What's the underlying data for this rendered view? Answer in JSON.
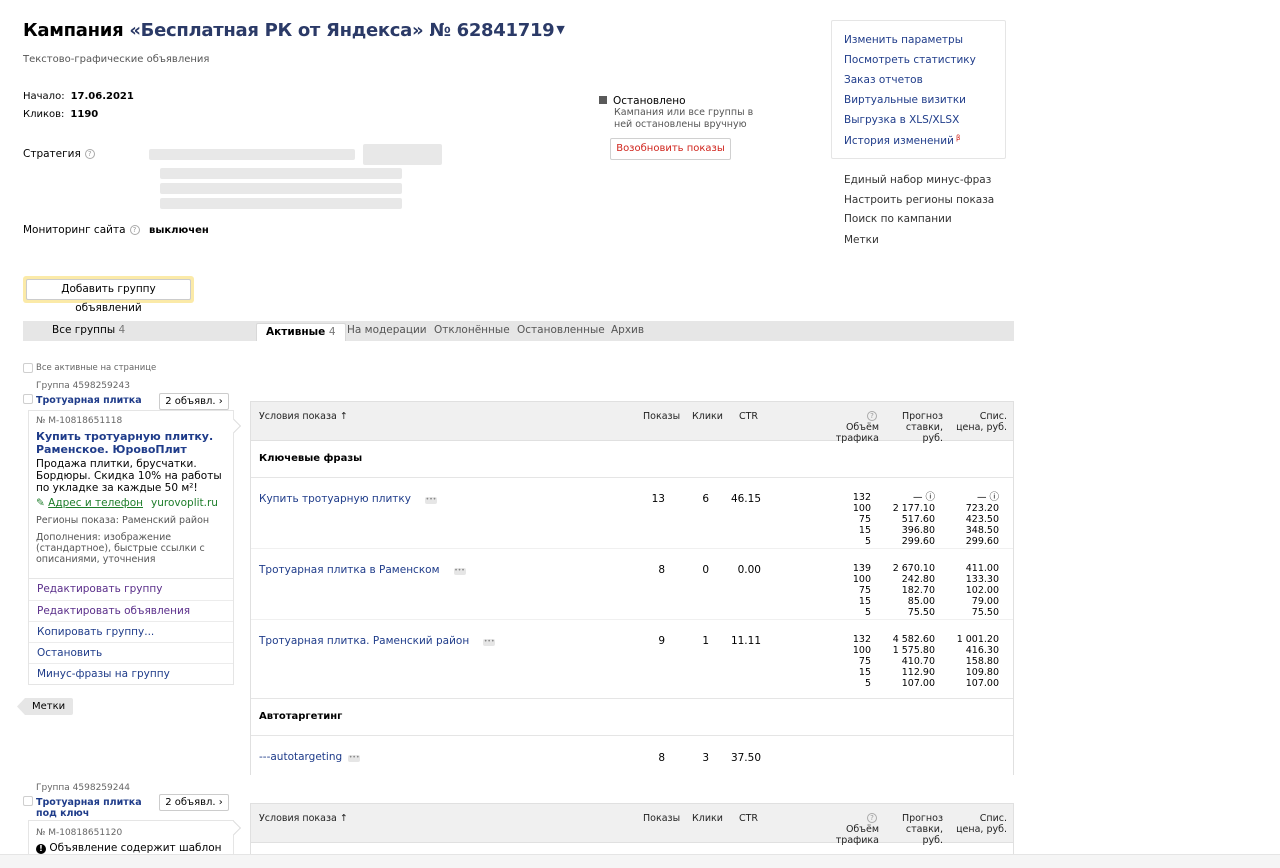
{
  "header": {
    "title_prefix": "Кампания",
    "campaign_name": "«Бесплатная РК от Яндекса» № 62841719",
    "subtitle": "Текстово-графические объявления",
    "start_label": "Начало:",
    "start_value": "17.06.2021",
    "clicks_label": "Кликов:",
    "clicks_value": "1190",
    "strategy_label": "Стратегия",
    "monitoring_label": "Мониторинг сайта",
    "monitoring_value": "выключен"
  },
  "status": {
    "label": "Остановлено",
    "note": "Кампания или все группы в ней остановлены вручную",
    "resume_button": "Возобновить показы"
  },
  "right_panel": {
    "links": [
      "Изменить параметры",
      "Посмотреть статистику",
      "Заказ отчетов",
      "Виртуальные визитки",
      "Выгрузка в XLS/XLSX",
      "История изменений"
    ],
    "history_badge": "β",
    "extra_links": [
      "Единый набор минус-фраз",
      "Настроить регионы показа",
      "Поиск по кампании",
      "Метки"
    ]
  },
  "add_group_button": "Добавить группу объявлений",
  "tabs": {
    "all_groups": "Все группы",
    "all_groups_count": "4",
    "active": "Активные",
    "active_count": "4",
    "moderation": "На модерации",
    "rejected": "Отклонённые",
    "stopped": "Остановленные",
    "archive": "Архив"
  },
  "select_all_active": "Все активные на странице",
  "group1": {
    "id": "Группа 4598259243",
    "name": "Тротуарная плитка",
    "ads_button": "2 объявл. ›",
    "ad_number": "№ М-10818651118",
    "ad_title": "Купить тротуарную плитку. Раменское. ЮровоПлит",
    "ad_text": "Продажа плитки, брусчатки. Бордюры. Скидка 10% на работы по укладке за каждые 50 м²!",
    "ad_contact": "Адрес и телефон",
    "ad_domain": "yurovoplit.ru",
    "ad_regions": "Регионы показа: Раменский район",
    "ad_extras": "Дополнения: изображение (стандартное), быстрые ссылки с описаниями, уточнения",
    "actions": [
      "Редактировать группу",
      "Редактировать объявления",
      "Копировать группу...",
      "Остановить",
      "Минус-фразы на группу"
    ],
    "tags": "Метки"
  },
  "table": {
    "col_conditions": "Условия показа ↑",
    "col_impressions": "Показы",
    "col_clicks": "Клики",
    "col_ctr": "CTR",
    "col_traffic": "Объём трафика",
    "col_forecast": "Прогноз ставки, руб.",
    "col_price": "Спис. цена, руб.",
    "section_keywords": "Ключевые фразы",
    "section_autotargeting": "Автотаргетинг",
    "rows": [
      {
        "phrase": "Купить тротуарную плитку",
        "impressions": "13",
        "clicks": "6",
        "ctr": "46.15",
        "traffic": "132\n100\n75\n15\n5",
        "forecast": "— ⓘ\n2 177.10\n517.60\n396.80\n299.60",
        "price": "— ⓘ\n723.20\n423.50\n348.50\n299.60"
      },
      {
        "phrase": "Тротуарная плитка в Раменском",
        "impressions": "8",
        "clicks": "0",
        "ctr": "0.00",
        "traffic": "139\n100\n75\n15\n5",
        "forecast": "2 670.10\n242.80\n182.70\n85.00\n75.50",
        "price": "411.00\n133.30\n102.00\n79.00\n75.50"
      },
      {
        "phrase": "Тротуарная плитка. Раменский район",
        "impressions": "9",
        "clicks": "1",
        "ctr": "11.11",
        "traffic": "132\n100\n75\n15\n5",
        "forecast": "4 582.60\n1 575.80\n410.70\n112.90\n107.00",
        "price": "1 001.20\n416.30\n158.80\n109.80\n107.00"
      }
    ],
    "autotarget_row": {
      "phrase": "---autotargeting",
      "impressions": "8",
      "clicks": "3",
      "ctr": "37.50"
    }
  },
  "group2": {
    "id": "Группа 4598259244",
    "name": "Тротуарная плитка под ключ",
    "ads_button": "2 объявл. ›",
    "ad_number": "№ М-10818651120",
    "ad_warning": "Объявление содержит шаблон"
  }
}
